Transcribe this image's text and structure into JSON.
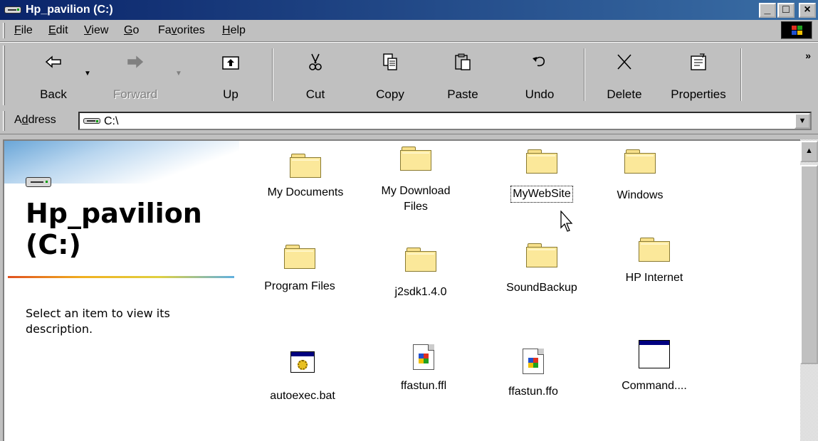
{
  "window": {
    "title": "Hp_pavilion (C:)",
    "minimize": "_",
    "maximize": "□",
    "close": "×"
  },
  "menu": {
    "items": [
      {
        "first": "F",
        "rest": "ile"
      },
      {
        "first": "E",
        "rest": "dit"
      },
      {
        "first": "V",
        "rest": "iew"
      },
      {
        "first": "G",
        "rest": "o"
      },
      {
        "first": "Fa",
        "ulet": "v",
        "rest2": "orites"
      },
      {
        "first": "H",
        "rest": "elp"
      }
    ]
  },
  "toolbar": {
    "back": "Back",
    "forward": "Forward",
    "up": "Up",
    "cut": "Cut",
    "copy": "Copy",
    "paste": "Paste",
    "undo": "Undo",
    "delete": "Delete",
    "properties": "Properties",
    "more": "»"
  },
  "address": {
    "label_pre": "A",
    "label_u": "d",
    "label_post": "dress",
    "value": "C:\\"
  },
  "panel": {
    "title": "Hp_pavilion (C:)",
    "description": "Select an item to view its description."
  },
  "items": [
    {
      "label": "My Documents"
    },
    {
      "label": "My Download Files"
    },
    {
      "label": "MyWebSite"
    },
    {
      "label": "Windows"
    },
    {
      "label": "Program Files"
    },
    {
      "label": "j2sdk1.4.0"
    },
    {
      "label": "SoundBackup"
    },
    {
      "label": "HP Internet"
    },
    {
      "label": "autoexec.bat"
    },
    {
      "label": "ffastun.ffl"
    },
    {
      "label": "ffastun.ffo"
    },
    {
      "label": "Command...."
    }
  ],
  "icons": {
    "drive": "hard-drive-icon",
    "folder": "folder-icon",
    "batch": "batch-file-icon",
    "document": "windows-document-icon",
    "program": "program-window-icon"
  }
}
